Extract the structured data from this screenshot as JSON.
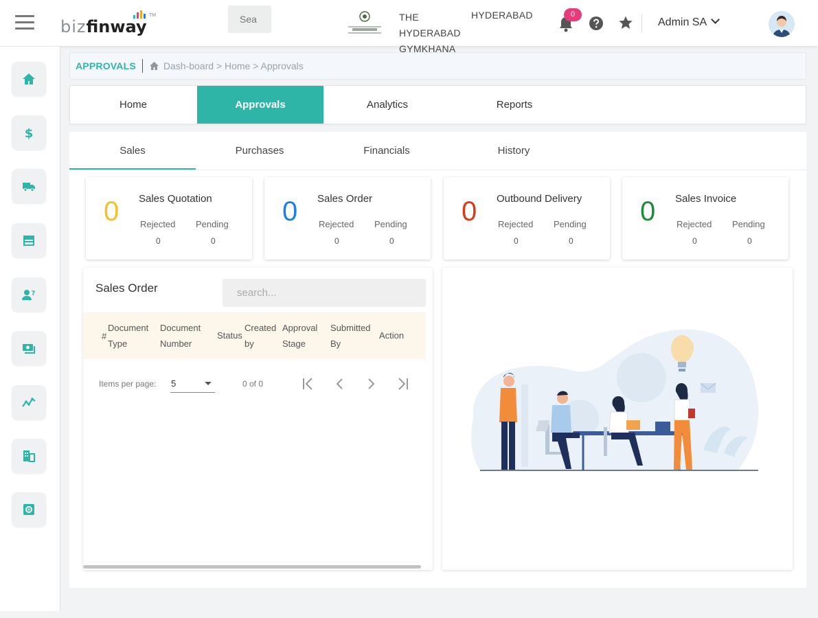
{
  "header": {
    "logo_part1": "biz",
    "logo_part2": "finway",
    "logo_tm": "TM",
    "search_placeholder": "Sea",
    "club_name_lines": [
      "THE",
      "HYDERABAD",
      "GYMKHANA"
    ],
    "club_city": "HYDERABAD",
    "notification_count": "0",
    "user_name": "Admin SA"
  },
  "sidebar": {
    "items": [
      {
        "icon": "home-icon"
      },
      {
        "icon": "dollar-icon"
      },
      {
        "icon": "truck-icon"
      },
      {
        "icon": "store-icon"
      },
      {
        "icon": "user-question-icon"
      },
      {
        "icon": "cash-icon"
      },
      {
        "icon": "analytics-icon"
      },
      {
        "icon": "building-icon"
      },
      {
        "icon": "settings-icon"
      }
    ]
  },
  "breadcrumb": {
    "section": "APPROVALS",
    "path": "Dash-board > Home > Approvals"
  },
  "main_tabs": [
    {
      "label": "Home",
      "active": false
    },
    {
      "label": "Approvals",
      "active": true
    },
    {
      "label": "Analytics",
      "active": false
    },
    {
      "label": "Reports",
      "active": false
    }
  ],
  "sub_tabs": [
    {
      "label": "Sales",
      "active": true
    },
    {
      "label": "Purchases",
      "active": false
    },
    {
      "label": "Financials",
      "active": false
    },
    {
      "label": "History",
      "active": false
    }
  ],
  "cards": [
    {
      "title": "Sales Quotation",
      "count": "0",
      "color": "#f2c12e",
      "rejected_label": "Rejected",
      "pending_label": "Pending",
      "rejected": "0",
      "pending": "0"
    },
    {
      "title": "Sales Order",
      "count": "0",
      "color": "#1e7fe6",
      "rejected_label": "Rejected",
      "pending_label": "Pending",
      "rejected": "0",
      "pending": "0"
    },
    {
      "title": "Outbound Delivery",
      "count": "0",
      "color": "#d93a17",
      "rejected_label": "Rejected",
      "pending_label": "Pending",
      "rejected": "0",
      "pending": "0"
    },
    {
      "title": "Sales Invoice",
      "count": "0",
      "color": "#1f8a3a",
      "rejected_label": "Rejected",
      "pending_label": "Pending",
      "rejected": "0",
      "pending": "0"
    }
  ],
  "sales_order_panel": {
    "title": "Sales Order",
    "search_placeholder": "search...",
    "columns": [
      {
        "line1": "#",
        "line2": ""
      },
      {
        "line1": "Document",
        "line2": "Type"
      },
      {
        "line1": "Document",
        "line2": "Number"
      },
      {
        "line1": "Status",
        "line2": ""
      },
      {
        "line1": "Created",
        "line2": "by"
      },
      {
        "line1": "Approval",
        "line2": "Stage"
      },
      {
        "line1": "Submitted",
        "line2": "By"
      },
      {
        "line1": "Action",
        "line2": ""
      }
    ],
    "items_per_page_label": "Items per page:",
    "items_per_page": "5",
    "range_label": "0 of 0"
  },
  "colors": {
    "accent": "#2fb5a8",
    "crumb_bg": "#f4f7fb",
    "table_header_bg": "#fcf7ea"
  }
}
